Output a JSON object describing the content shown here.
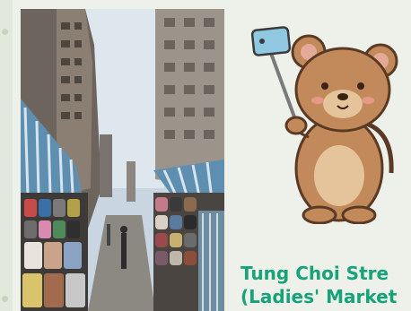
{
  "caption": {
    "line1": "Tung Choi Stre",
    "line2": "(Ladies' Market"
  },
  "colors": {
    "caption": "#16a37a",
    "background": "#eef1ea",
    "bear_fur": "#c28a5a",
    "phone": "#8fc8e0"
  },
  "icons": {
    "mascot": "bear-mascot-with-selfie-stick",
    "phone": "smartphone-icon"
  }
}
